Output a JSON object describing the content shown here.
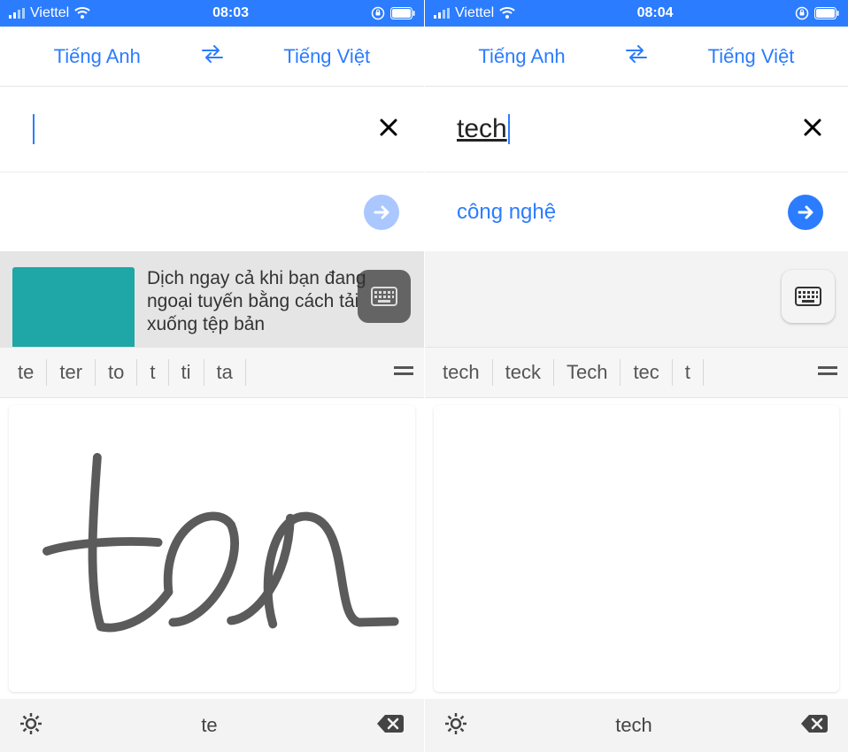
{
  "screens": [
    {
      "statusbar": {
        "carrier": "Viettel",
        "time": "08:03"
      },
      "langbar": {
        "src": "Tiếng Anh",
        "dst": "Tiếng Việt"
      },
      "input": {
        "text": ""
      },
      "result": {
        "text": ""
      },
      "tip": {
        "text": "Dịch ngay cả khi bạn đang ngoại tuyến bằng cách tải xuống tệp bản"
      },
      "suggestions": [
        "te",
        "ter",
        "to",
        "t",
        "ti",
        "ta"
      ],
      "bottom_text": "te"
    },
    {
      "statusbar": {
        "carrier": "Viettel",
        "time": "08:04"
      },
      "langbar": {
        "src": "Tiếng Anh",
        "dst": "Tiếng Việt"
      },
      "input": {
        "text": "tech"
      },
      "result": {
        "text": "công nghệ"
      },
      "suggestions": [
        "tech",
        "teck",
        "Tech",
        "tec",
        "t"
      ],
      "bottom_text": "tech"
    }
  ]
}
